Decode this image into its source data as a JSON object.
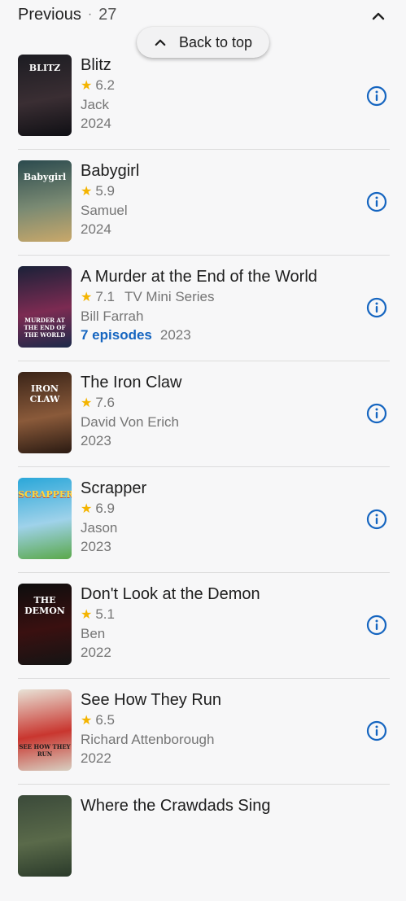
{
  "header": {
    "title": "Previous",
    "separator": "·",
    "count": "27"
  },
  "back_to_top": {
    "label": "Back to top"
  },
  "items": [
    {
      "title": "Blitz",
      "rating": "6.2",
      "extra": "",
      "role": "Jack",
      "episodes": "",
      "year": "2024",
      "poster": {
        "text": "BLITZ",
        "colors": [
          "#1c1c22",
          "#3a2e33",
          "#0f0f14"
        ]
      }
    },
    {
      "title": "Babygirl",
      "rating": "5.9",
      "extra": "",
      "role": "Samuel",
      "episodes": "",
      "year": "2024",
      "poster": {
        "text": "Babygirl",
        "colors": [
          "#2b4a4e",
          "#7a8a73",
          "#c9a86a"
        ]
      }
    },
    {
      "title": "A Murder at the End of the World",
      "rating": "7.1",
      "extra": "TV Mini Series",
      "role": "Bill Farrah",
      "episodes": "7 episodes",
      "year": "2023",
      "poster": {
        "text": "MURDER AT THE END OF THE WORLD",
        "colors": [
          "#1a2138",
          "#7c2b52",
          "#1c2a4a"
        ]
      }
    },
    {
      "title": "The Iron Claw",
      "rating": "7.6",
      "extra": "",
      "role": "David Von Erich",
      "episodes": "",
      "year": "2023",
      "poster": {
        "text": "IRON CLAW",
        "colors": [
          "#3a2418",
          "#8a5a3a",
          "#2a1a12"
        ]
      }
    },
    {
      "title": "Scrapper",
      "rating": "6.9",
      "extra": "",
      "role": "Jason",
      "episodes": "",
      "year": "2023",
      "poster": {
        "text": "SCRAPPER",
        "colors": [
          "#2aa7d9",
          "#9fd2ea",
          "#5aa84a"
        ]
      }
    },
    {
      "title": "Don't Look at the Demon",
      "rating": "5.1",
      "extra": "",
      "role": "Ben",
      "episodes": "",
      "year": "2022",
      "poster": {
        "text": "THE DEMON",
        "colors": [
          "#0d0d0d",
          "#3a1010",
          "#141414"
        ]
      }
    },
    {
      "title": "See How They Run",
      "rating": "6.5",
      "extra": "",
      "role": "Richard Attenborough",
      "episodes": "",
      "year": "2022",
      "poster": {
        "text": "SEE HOW THEY RUN",
        "colors": [
          "#e8e2d6",
          "#c9362f",
          "#d8d0c2"
        ]
      }
    },
    {
      "title": "Where the Crawdads Sing",
      "rating": "",
      "extra": "",
      "role": "",
      "episodes": "",
      "year": "",
      "poster": {
        "text": "",
        "colors": [
          "#3b4a3a",
          "#5a6a4a",
          "#2a3a2a"
        ]
      }
    }
  ]
}
